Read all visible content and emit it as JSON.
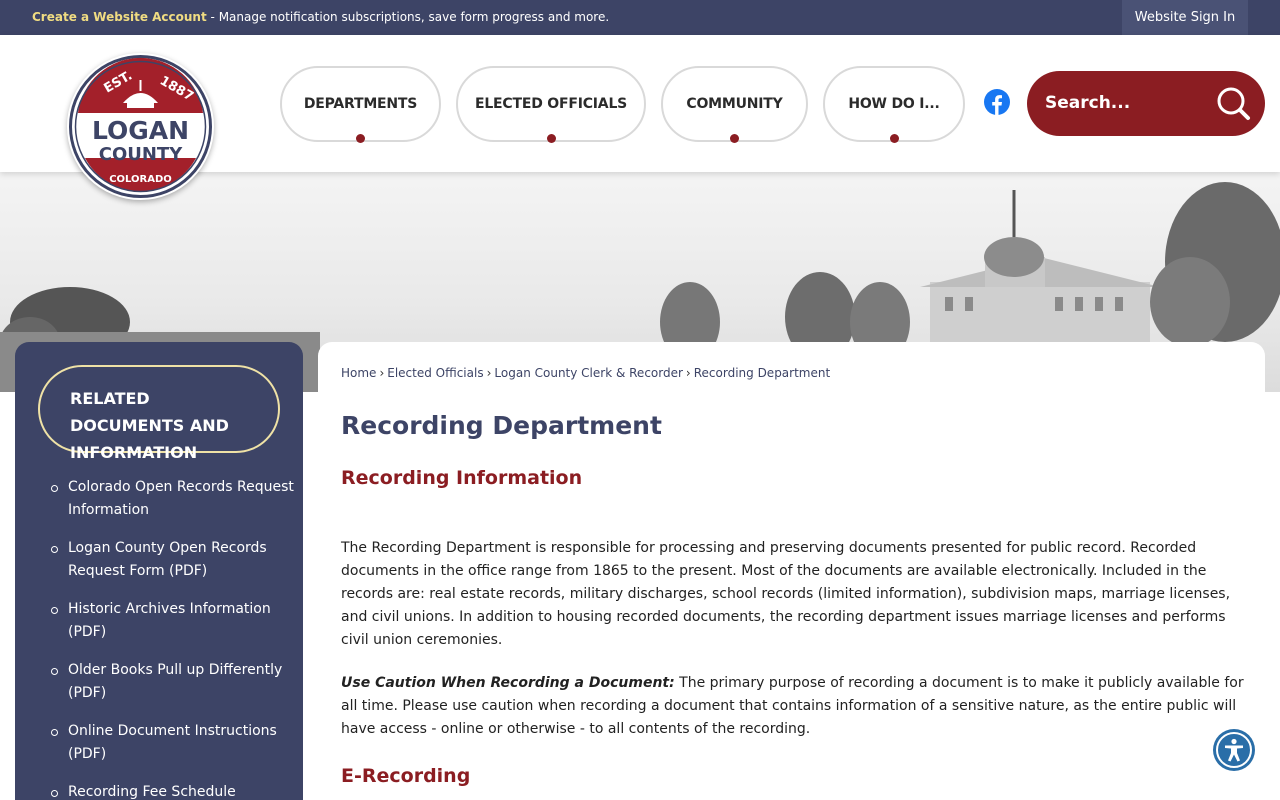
{
  "topbar": {
    "account_link": "Create a Website Account",
    "account_desc": "- Manage notification subscriptions, save form progress and more.",
    "signin": "Website Sign In"
  },
  "logo": {
    "est": "EST. 1887",
    "line1": "LOGAN",
    "line2": "COUNTY",
    "state": "COLORADO"
  },
  "nav": [
    {
      "label": "DEPARTMENTS"
    },
    {
      "label": "ELECTED OFFICIALS"
    },
    {
      "label": "COMMUNITY"
    },
    {
      "label": "HOW DO I..."
    }
  ],
  "search": {
    "placeholder": "Search..."
  },
  "sidebar": {
    "title": "RELATED DOCUMENTS AND INFORMATION",
    "items": [
      "Colorado Open Records Request Information",
      "Logan County Open Records Request Form (PDF)",
      "Historic Archives Information (PDF)",
      "Older Books Pull up Differently (PDF)",
      "Online Document Instructions (PDF)",
      "Recording Fee Schedule"
    ]
  },
  "breadcrumbs": [
    "Home",
    "Elected Officials",
    "Logan County Clerk & Recorder",
    "Recording Department"
  ],
  "page": {
    "title": "Recording Department",
    "section1_title": "Recording Information",
    "para1": "The Recording Department is responsible for processing and preserving documents presented for public record. Recorded documents in the office range from 1865 to the present. Most of the documents are available electronically. Included in the records are: real estate records, military discharges, school records (limited information), subdivision maps, marriage licenses, and civil unions. In addition to housing recorded documents, the recording department issues marriage licenses and performs civil union ceremonies.",
    "caution_label": "Use Caution When Recording a Document:",
    "caution_text": " The primary purpose of recording a document is to make it publicly available for all time. Please use caution when recording a document that contains information of a sensitive nature, as the entire public will have access - online or otherwise - to all contents of the recording.",
    "section2_title": "E-Recording"
  },
  "colors": {
    "navy": "#3d4466",
    "maroon": "#8b1d22",
    "gold": "#f0dc82"
  }
}
